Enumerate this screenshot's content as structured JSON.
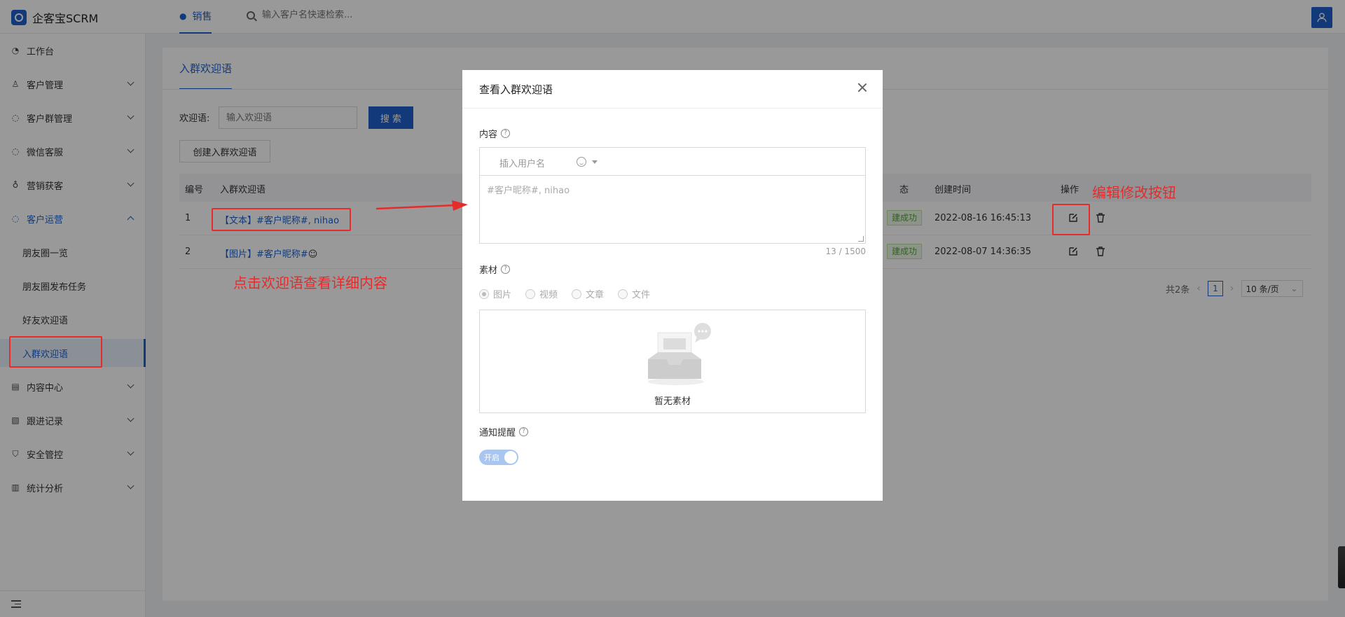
{
  "app": {
    "name": "企客宝SCRM"
  },
  "topbar": {
    "tab_label": "销售",
    "search_placeholder": "输入客户名快速检索..."
  },
  "sidebar": {
    "items": [
      {
        "label": "工作台"
      },
      {
        "label": "客户管理"
      },
      {
        "label": "客户群管理"
      },
      {
        "label": "微信客服"
      },
      {
        "label": "营销获客"
      },
      {
        "label": "客户运营"
      },
      {
        "label": "朋友圈一览"
      },
      {
        "label": "朋友圈发布任务"
      },
      {
        "label": "好友欢迎语"
      },
      {
        "label": "入群欢迎语"
      },
      {
        "label": "内容中心"
      },
      {
        "label": "跟进记录"
      },
      {
        "label": "安全管控"
      },
      {
        "label": "统计分析"
      }
    ]
  },
  "page": {
    "tab_label": "入群欢迎语",
    "filter_label": "欢迎语:",
    "filter_placeholder": "输入欢迎语",
    "search_button": "搜 索",
    "create_button": "创建入群欢迎语",
    "table": {
      "columns": [
        "编号",
        "入群欢迎语",
        "态",
        "创建时间",
        "操作"
      ],
      "rows": [
        {
          "id": "1",
          "content": "【文本】#客户昵称#, nihao",
          "status": "建成功",
          "created": "2022-08-16 16:45:13"
        },
        {
          "id": "2",
          "content": "【图片】#客户昵称#",
          "status": "建成功",
          "created": "2022-08-07 14:36:35"
        }
      ]
    },
    "pager": {
      "total": "共2条",
      "current": "1",
      "page_size": "10 条/页"
    }
  },
  "modal": {
    "title": "查看入群欢迎语",
    "content_label": "内容",
    "insert_user": "插入用户名",
    "editor_text": "#客户昵称#, nihao",
    "counter": "13 / 1500",
    "material_label": "素材",
    "material_options": [
      "图片",
      "视频",
      "文章",
      "文件"
    ],
    "empty_text": "暂无素材",
    "notify_label": "通知提醒",
    "switch_text": "开启",
    "switch_on": true
  },
  "annotations": {
    "click_hint": "点击欢迎语查看详细内容",
    "edit_hint": "编辑修改按钮"
  },
  "colors": {
    "primary": "#1f62cc",
    "annotation": "#e52b2b",
    "success": "#52a633"
  }
}
